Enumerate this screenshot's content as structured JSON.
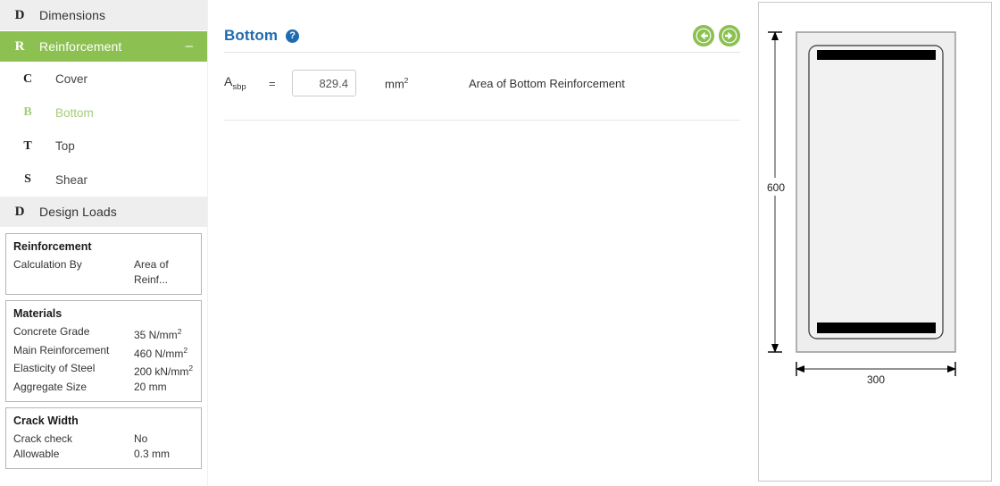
{
  "sidebar": {
    "groups": [
      {
        "letter": "D",
        "label": "Dimensions",
        "active": false,
        "toggle": ""
      },
      {
        "letter": "R",
        "label": "Reinforcement",
        "active": true,
        "toggle": "–"
      }
    ],
    "sub_items": [
      {
        "letter": "C",
        "label": "Cover",
        "current": false
      },
      {
        "letter": "B",
        "label": "Bottom",
        "current": true
      },
      {
        "letter": "T",
        "label": "Top",
        "current": false
      },
      {
        "letter": "S",
        "label": "Shear",
        "current": false
      }
    ],
    "design_loads": {
      "letter": "D",
      "label": "Design Loads"
    },
    "cards": [
      {
        "title": "Reinforcement",
        "rows": [
          {
            "key": "Calculation By",
            "value": "Area of",
            "value2": "Reinf..."
          }
        ]
      },
      {
        "title": "Materials",
        "rows": [
          {
            "key": "Concrete Grade",
            "value": "35 N/mm",
            "sup": "2"
          },
          {
            "key": "Main Reinforcement",
            "value": "460 N/mm",
            "sup": "2"
          },
          {
            "key": "Elasticity of Steel",
            "value": "200 kN/mm",
            "sup": "2"
          },
          {
            "key": "Aggregate Size",
            "value": "20 mm"
          }
        ]
      },
      {
        "title": "Crack Width",
        "rows": [
          {
            "key": "Crack check",
            "value": "No"
          },
          {
            "key": "Allowable",
            "value": "0.3 mm"
          }
        ]
      }
    ]
  },
  "main": {
    "title": "Bottom",
    "help_icon": "?",
    "prev_label": "previous",
    "next_label": "next",
    "field": {
      "symbol": "A",
      "subscript": "sbp",
      "equals": "=",
      "value": "829.4",
      "placeholder": "",
      "unit": "mm",
      "unit_sup": "2",
      "description": "Area of Bottom Reinforcement"
    }
  },
  "diagram": {
    "height_label": "600",
    "width_label": "300",
    "accent": "#8cc152",
    "title_color": "#1f6bb0"
  }
}
